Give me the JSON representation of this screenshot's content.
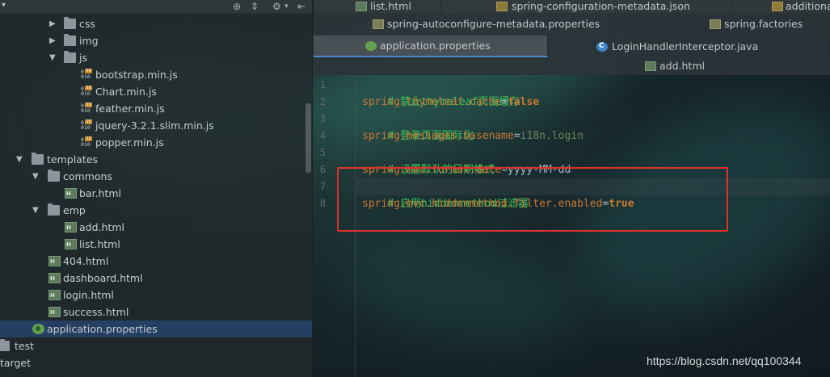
{
  "project_tree": [
    {
      "label": "css",
      "type": "folder",
      "expanded": false
    },
    {
      "label": "img",
      "type": "folder",
      "expanded": false
    },
    {
      "label": "js",
      "type": "folder",
      "expanded": true
    },
    {
      "label": "bootstrap.min.js",
      "type": "js-file"
    },
    {
      "label": "Chart.min.js",
      "type": "js-file"
    },
    {
      "label": "feather.min.js",
      "type": "js-file"
    },
    {
      "label": "jquery-3.2.1.slim.min.js",
      "type": "js-file"
    },
    {
      "label": "popper.min.js",
      "type": "js-file"
    },
    {
      "label": "templates",
      "type": "folder",
      "expanded": true
    },
    {
      "label": "commons",
      "type": "folder",
      "expanded": true
    },
    {
      "label": "bar.html",
      "type": "html-file"
    },
    {
      "label": "emp",
      "type": "folder",
      "expanded": true
    },
    {
      "label": "add.html",
      "type": "html-file"
    },
    {
      "label": "list.html",
      "type": "html-file"
    },
    {
      "label": "404.html",
      "type": "html-file"
    },
    {
      "label": "dashboard.html",
      "type": "html-file"
    },
    {
      "label": "login.html",
      "type": "html-file"
    },
    {
      "label": "success.html",
      "type": "html-file"
    },
    {
      "label": "application.properties",
      "type": "properties-file",
      "selected": true
    },
    {
      "label": "test",
      "type": "folder",
      "expanded": false
    },
    {
      "label": "target",
      "type": "folder",
      "expanded": false
    }
  ],
  "tabs": {
    "row1": [
      "list.html",
      "spring-configuration-metadata.json",
      "additiona"
    ],
    "row2": [
      "spring-autoconfigure-metadata.properties",
      "spring.factories"
    ],
    "row3": [
      "application.properties",
      "LoginHandlerInterceptor.java"
    ],
    "row4": [
      "add.html"
    ],
    "active": "application.properties"
  },
  "editor": {
    "line_numbers": [
      "1",
      "2",
      "3",
      "4",
      "5",
      "6",
      "7",
      "8"
    ],
    "lines": [
      {
        "comment": "# 禁止thymeleaf页面缓存"
      },
      {
        "key": "spring.thymeleaf.cache",
        "eq": "=",
        "value": "false",
        "value_kind": "keyword"
      },
      {
        "comment": "# 登录页面国际化"
      },
      {
        "key": "spring.messages.basename",
        "eq": "=",
        "value": "i18n.login",
        "value_kind": "string"
      },
      {
        "comment": "# 设置默认的日期格式"
      },
      {
        "key": "spring.mvc.format.date",
        "eq": "=",
        "value": "yyyy-MM-dd",
        "value_kind": "plain"
      },
      {
        "comment": "# 启用hiddenmethod过滤器"
      },
      {
        "key": "spring.mvc.hiddenmethod.filter.enabled",
        "eq": "=",
        "value": "true",
        "value_kind": "keyword"
      }
    ]
  },
  "watermark": "https://blog.csdn.net/qq100344",
  "colors": {
    "comment": "#3ec45e",
    "key": "#cc7832",
    "highlight_box": "#e0322a",
    "selection": "#26446c"
  }
}
